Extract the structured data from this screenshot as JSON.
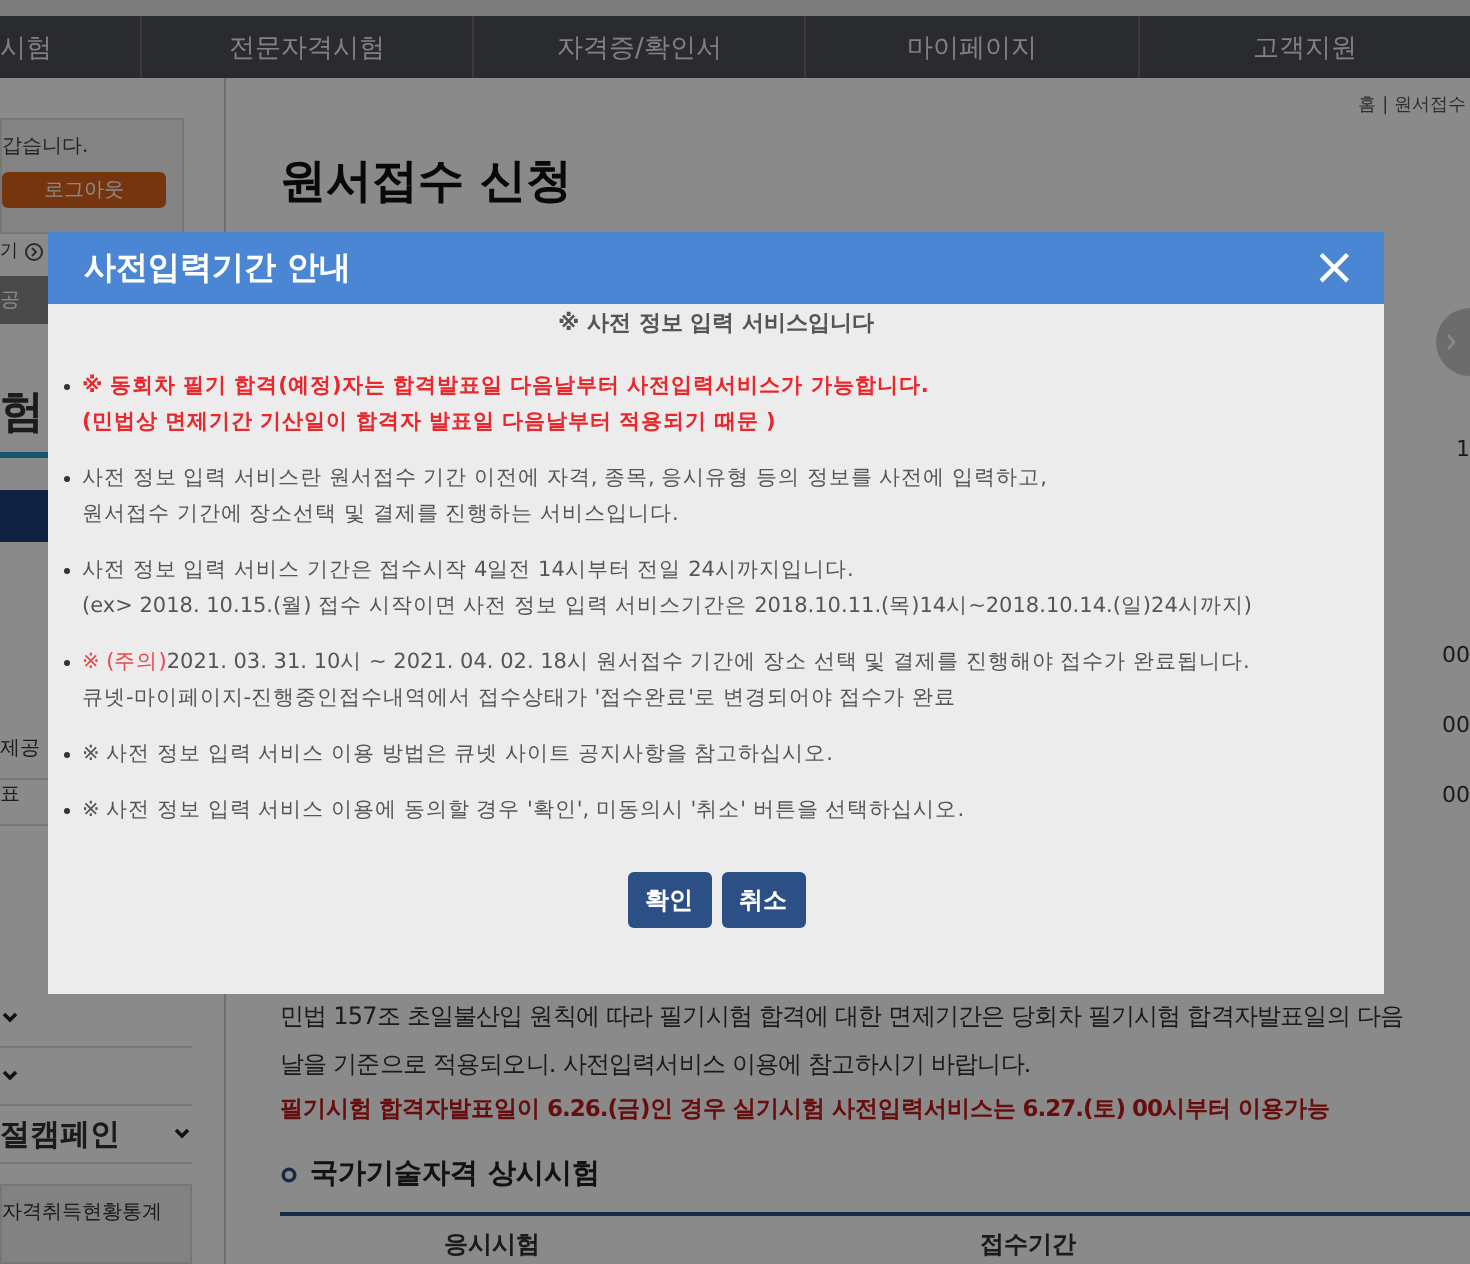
{
  "nav": {
    "items": [
      "시험",
      "전문자격시험",
      "자격증/확인서",
      "마이페이지",
      "고객지원"
    ]
  },
  "sidebar": {
    "greeting": "갑습니다.",
    "logout": "로그아웃",
    "link": "기",
    "tab": "공",
    "heading": "험",
    "rows": [
      "제공",
      "표"
    ],
    "menu": [
      {
        "kind": "toggle"
      },
      {
        "kind": "toggle"
      },
      {
        "kind": "toggle",
        "label": "절캠페인"
      }
    ],
    "stats": "자격취득현황통계"
  },
  "main": {
    "breadcrumb": "홈 | 원서접수",
    "title": "원서접수 신청",
    "side": [
      "1",
      "00",
      "00",
      "00"
    ],
    "notice": "민법 157조 초일불산입 원칙에 따라 필기시험 합격에 대한 면제기간은 당회차 필기시험 합격자발표일의 다음날을 기준으로 적용되오니. 사전입력서비스 이용에 참고하시기 바랍니다.",
    "warning": "필기시험 합격자발표일이 6.26.(금)인 경우 실기시험 사전입력서비스는 6.27.(토) 00시부터 이용가능",
    "section": "국가기술자격 상시시험",
    "columns": [
      "응시시험",
      "접수기간"
    ]
  },
  "dialog": {
    "title": "사전입력기간 안내",
    "close": "×",
    "subtitle": "※ 사전 정보 입력 서비스입니다",
    "items": [
      {
        "kind": "red",
        "lines": [
          "※ 동회차 필기 합격(예정)자는 합격발표일 다음날부터 사전입력서비스가 가능합니다.",
          "(민법상 면제기간 기산일이 합격자 발표일 다음날부터 적용되기 때문 )"
        ]
      },
      {
        "kind": "normal",
        "lines": [
          "사전 정보 입력 서비스란 원서접수 기간 이전에 자격, 종목, 응시유형 등의 정보를 사전에 입력하고,",
          "원서접수 기간에 장소선택 및 결제를 진행하는 서비스입니다."
        ]
      },
      {
        "kind": "normal",
        "lines": [
          "사전 정보 입력 서비스 기간은 접수시작 4일전 14시부터 전일 24시까지입니다.",
          "(ex> 2018. 10.15.(월) 접수 시작이면 사전 정보 입력 서비스기간은 2018.10.11.(목)14시~2018.10.14.(일)24시까지)"
        ]
      },
      {
        "kind": "caution",
        "prefix": "※ (주의)",
        "lines": [
          "2021. 03. 31. 10시 ~ 2021. 04. 02. 18시 원서접수 기간에 장소 선택 및 결제를 진행해야 접수가 완료됩니다.",
          "큐넷-마이페이지-진행중인접수내역에서 접수상태가 '접수완료'로 변경되어야 접수가 완료"
        ]
      },
      {
        "kind": "normal",
        "lines": [
          "※ 사전 정보 입력 서비스 이용 방법은 큐넷 사이트 공지사항을 참고하십시오."
        ]
      },
      {
        "kind": "normal",
        "lines": [
          "※ 사전 정보 입력 서비스 이용에 동의할 경우 '확인', 미동의시 '취소' 버튼을 선택하십시오."
        ]
      }
    ],
    "buttons": [
      "확인",
      "취소"
    ]
  }
}
